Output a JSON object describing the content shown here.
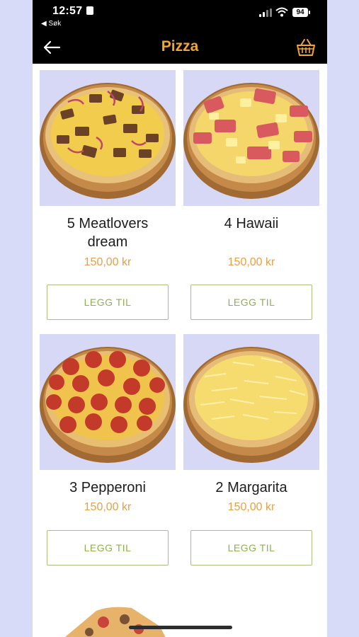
{
  "status_bar": {
    "time": "12:57",
    "back_app": "◀ Søk",
    "battery": "94"
  },
  "nav": {
    "title": "Pizza",
    "back_icon": "arrow-left-icon",
    "basket_icon": "basket-icon"
  },
  "colors": {
    "accent": "#f0a534",
    "price": "#e6a046",
    "button": "#8fb04f"
  },
  "products": [
    {
      "name": "5 Meatlovers dream",
      "price": "150,00 kr",
      "button": "LEGG TIL"
    },
    {
      "name": "4 Hawaii",
      "price": "150,00 kr",
      "button": "LEGG TIL"
    },
    {
      "name": "3 Pepperoni",
      "price": "150,00 kr",
      "button": "LEGG TIL"
    },
    {
      "name": "2 Margarita",
      "price": "150,00 kr",
      "button": "LEGG TIL"
    }
  ]
}
